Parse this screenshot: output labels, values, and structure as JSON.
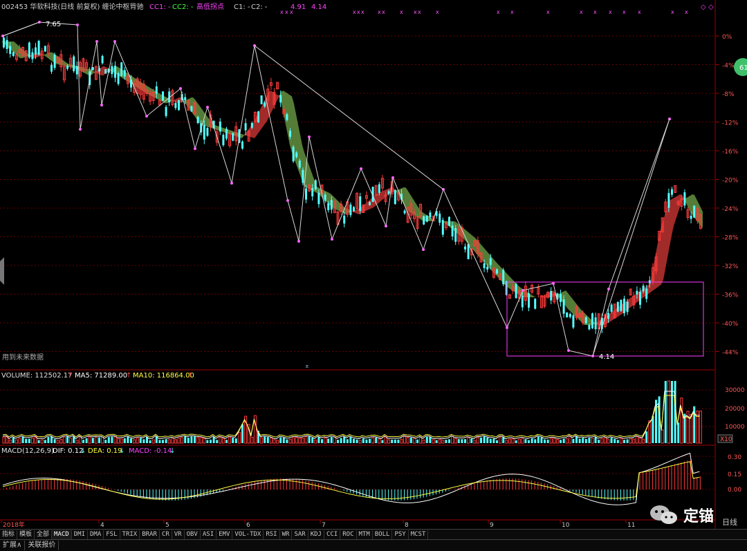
{
  "header": {
    "code": "002453",
    "name": "华软科技",
    "mode": "(日线 前复权)",
    "indicator": "缠论中枢背驰",
    "cc1": "CC1: -",
    "cc2": "CC2: -",
    "pivot": "高低拐点",
    "c1": "C1: -",
    "c2": "C2: -",
    "val_a": "4.91",
    "val_b": "4.14"
  },
  "price_axis": [
    "0%",
    "-4%",
    "-8%",
    "-12%",
    "-16%",
    "-20%",
    "-24%",
    "-28%",
    "-32%",
    "-36%",
    "-40%",
    "-44%"
  ],
  "annotations": {
    "high": "7.65",
    "low": "4.14",
    "future": "用到未来数据",
    "badge": "61"
  },
  "volume": {
    "label": "VOLUME: 112502.17",
    "ma5": "MA5: 71289.00",
    "ma10": "MA10: 116864.00",
    "axis": [
      "30000",
      "20000",
      "10000"
    ],
    "unit": "X10"
  },
  "macd": {
    "label": "MACD(12,26,9)",
    "dif": "DIF: 0.12",
    "dea": "DEA: 0.19",
    "macd": "MACD: -0.14",
    "axis": [
      "0.30",
      "0.15",
      "0.00"
    ]
  },
  "date_axis": [
    "2018年",
    "4",
    "5",
    "6",
    "7",
    "8",
    "9",
    "10",
    "11"
  ],
  "tabs": [
    "指标",
    "模板",
    "全部",
    "MACD",
    "DMI",
    "DMA",
    "FSL",
    "TRIX",
    "BRAR",
    "CR",
    "VR",
    "OBV",
    "ASI",
    "EMV",
    "VOL-TDX",
    "RSI",
    "WR",
    "SAR",
    "KDJ",
    "CCI",
    "ROC",
    "MTM",
    "BOLL",
    "PSY",
    "MCST"
  ],
  "bottom_tabs": [
    "扩展∧",
    "关联报价"
  ],
  "watermark": "定锚",
  "period": "日线",
  "scale_buttons": [
    "+",
    "-"
  ],
  "colors": {
    "up": "#ff3b3b",
    "down": "#54ffff",
    "grid": "#8a0000",
    "ma5": "#ffffff",
    "ma10": "#ffff33",
    "pink": "#ff3fff",
    "green_band": "#5e8a3c",
    "red_band": "#b2302e"
  }
}
